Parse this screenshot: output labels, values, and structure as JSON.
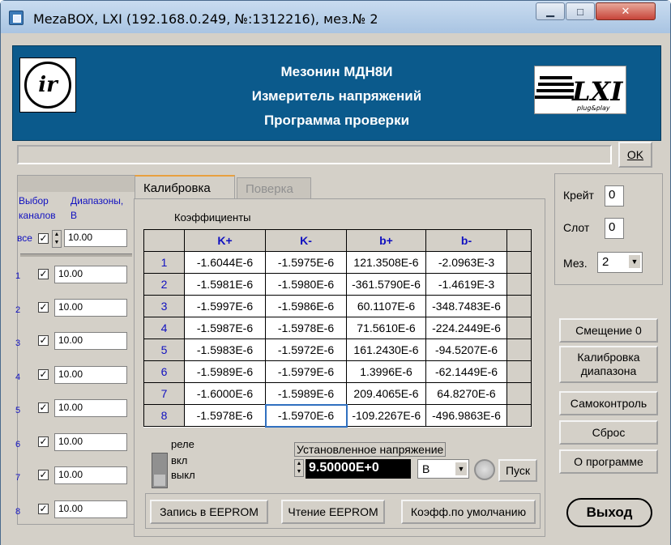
{
  "window": {
    "title": "MezaBOX, LXI (192.168.0.249, №:1312216), мез.№ 2",
    "minimize_glyph": "▁",
    "maximize_glyph": "□",
    "close_glyph": "✕"
  },
  "header": {
    "line1": "Мезонин МДН8И",
    "line2": "Измеритель напряжений",
    "line3": "Программа проверки",
    "logo_left_text": "ir",
    "logo_right_text": "LXI",
    "logo_right_sub": "plug&play"
  },
  "status": {
    "text": "",
    "ok_label": "OK"
  },
  "channels": {
    "select_label_1": "Выбор",
    "select_label_2": "каналов",
    "range_label_1": "Диапазоны,",
    "range_label_2": "В",
    "all_label": "все",
    "all_checked": true,
    "all_value": "10.00",
    "items": [
      {
        "num": "1",
        "checked": true,
        "value": "10.00"
      },
      {
        "num": "2",
        "checked": true,
        "value": "10.00"
      },
      {
        "num": "3",
        "checked": true,
        "value": "10.00"
      },
      {
        "num": "4",
        "checked": true,
        "value": "10.00"
      },
      {
        "num": "5",
        "checked": true,
        "value": "10.00"
      },
      {
        "num": "6",
        "checked": true,
        "value": "10.00"
      },
      {
        "num": "7",
        "checked": true,
        "value": "10.00"
      },
      {
        "num": "8",
        "checked": true,
        "value": "10.00"
      }
    ]
  },
  "tabs": {
    "calibration": "Калибровка",
    "verification": "Поверка",
    "active": "calibration"
  },
  "coefficients": {
    "label": "Коэффициенты",
    "headers": [
      "K+",
      "K-",
      "b+",
      "b-"
    ],
    "rows": [
      {
        "n": "1",
        "kp": "-1.6044E-6",
        "km": "-1.5975E-6",
        "bp": "121.3508E-6",
        "bm": "-2.0963E-3"
      },
      {
        "n": "2",
        "kp": "-1.5981E-6",
        "km": "-1.5980E-6",
        "bp": "-361.5790E-6",
        "bm": "-1.4619E-3"
      },
      {
        "n": "3",
        "kp": "-1.5997E-6",
        "km": "-1.5986E-6",
        "bp": "60.1107E-6",
        "bm": "-348.7483E-6"
      },
      {
        "n": "4",
        "kp": "-1.5987E-6",
        "km": "-1.5978E-6",
        "bp": "71.5610E-6",
        "bm": "-224.2449E-6"
      },
      {
        "n": "5",
        "kp": "-1.5983E-6",
        "km": "-1.5972E-6",
        "bp": "161.2430E-6",
        "bm": "-94.5207E-6"
      },
      {
        "n": "6",
        "kp": "-1.5989E-6",
        "km": "-1.5979E-6",
        "bp": "1.3996E-6",
        "bm": "-62.1449E-6"
      },
      {
        "n": "7",
        "kp": "-1.6000E-6",
        "km": "-1.5989E-6",
        "bp": "209.4065E-6",
        "bm": "64.8270E-6"
      },
      {
        "n": "8",
        "kp": "-1.5978E-6",
        "km": "-1.5970E-6",
        "bp": "-109.2267E-6",
        "bm": "-496.9863E-6"
      }
    ]
  },
  "relay": {
    "label": "реле",
    "on": "вкл",
    "off": "выкл"
  },
  "voltage": {
    "label": "Установленное напряжение",
    "value": "9.50000E+0",
    "unit": "В",
    "start_label": "Пуск"
  },
  "eeprom": {
    "write": "Запись в EEPROM",
    "read": "Чтение EEPROM",
    "defaults": "Коэфф.по умолчанию"
  },
  "device": {
    "crate_label": "Крейт",
    "crate_value": "0",
    "slot_label": "Слот",
    "slot_value": "0",
    "mez_label": "Мез.",
    "mez_value": "2"
  },
  "actions": {
    "offset": "Смещение 0",
    "range_cal_1": "Калибровка",
    "range_cal_2": "диапазона",
    "selftest": "Самоконтроль",
    "reset": "Сброс",
    "about": "О программе",
    "exit": "Выход"
  }
}
